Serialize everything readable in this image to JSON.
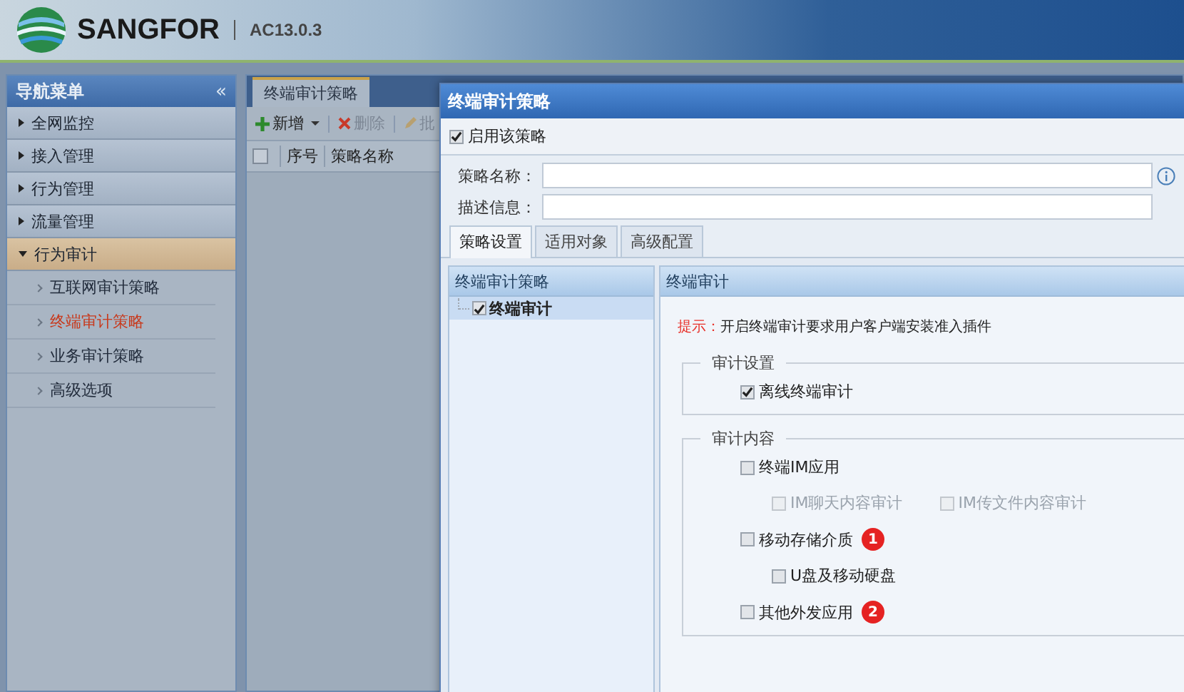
{
  "header": {
    "brand": "SANGFOR",
    "version": "AC13.0.3"
  },
  "nav": {
    "title": "导航菜单",
    "collapse": "«",
    "groups": [
      {
        "label": "全网监控",
        "expanded": false
      },
      {
        "label": "接入管理",
        "expanded": false
      },
      {
        "label": "行为管理",
        "expanded": false
      },
      {
        "label": "流量管理",
        "expanded": false
      },
      {
        "label": "行为审计",
        "expanded": true,
        "children": [
          {
            "label": "互联网审计策略",
            "selected": false
          },
          {
            "label": "终端审计策略",
            "selected": true
          },
          {
            "label": "业务审计策略",
            "selected": false
          },
          {
            "label": "高级选项",
            "selected": false
          }
        ]
      }
    ]
  },
  "main": {
    "tab": "终端审计策略",
    "toolbar": [
      {
        "kind": "add",
        "label": "新增",
        "disabled": false
      },
      {
        "kind": "delete",
        "label": "删除",
        "disabled": true
      },
      {
        "kind": "edit",
        "label": "批",
        "disabled": true
      }
    ],
    "select_all": {
      "checked": false
    },
    "columns": [
      "序号",
      "策略名称"
    ]
  },
  "dialog": {
    "title": "终端审计策略",
    "enable": {
      "label": "启用该策略",
      "checked": true
    },
    "fields": [
      {
        "label": "策略名称：",
        "info": true
      },
      {
        "label": "描述信息：",
        "info": false
      }
    ],
    "tabs": [
      {
        "label": "策略设置",
        "selected": true
      },
      {
        "label": "适用对象",
        "selected": false
      },
      {
        "label": "高级配置",
        "selected": false
      }
    ],
    "tree": {
      "title": "终端审计策略",
      "items": [
        {
          "label": "终端审计",
          "checked": true,
          "selected": true
        }
      ]
    },
    "content": {
      "title": "终端审计",
      "hint_label": "提示：",
      "hint": "开启终端审计要求用户客户端安装准入插件",
      "sections": [
        {
          "title": "审计设置",
          "options": [
            {
              "label": "离线终端审计",
              "checked": true,
              "disabled": false
            }
          ]
        },
        {
          "title": "审计内容",
          "options": [
            {
              "label": "终端IM应用",
              "checked": false,
              "disabled": false,
              "children": [
                {
                  "label": "IM聊天内容审计",
                  "checked": false,
                  "disabled": true
                },
                {
                  "label": "IM传文件内容审计",
                  "checked": false,
                  "disabled": true
                }
              ]
            },
            {
              "label": "移动存储介质",
              "checked": false,
              "disabled": false,
              "badge": "1",
              "children": [
                {
                  "label": "U盘及移动硬盘",
                  "checked": false,
                  "disabled": false
                }
              ]
            },
            {
              "label": "其他外发应用",
              "checked": false,
              "disabled": false,
              "badge": "2"
            }
          ]
        }
      ]
    }
  }
}
